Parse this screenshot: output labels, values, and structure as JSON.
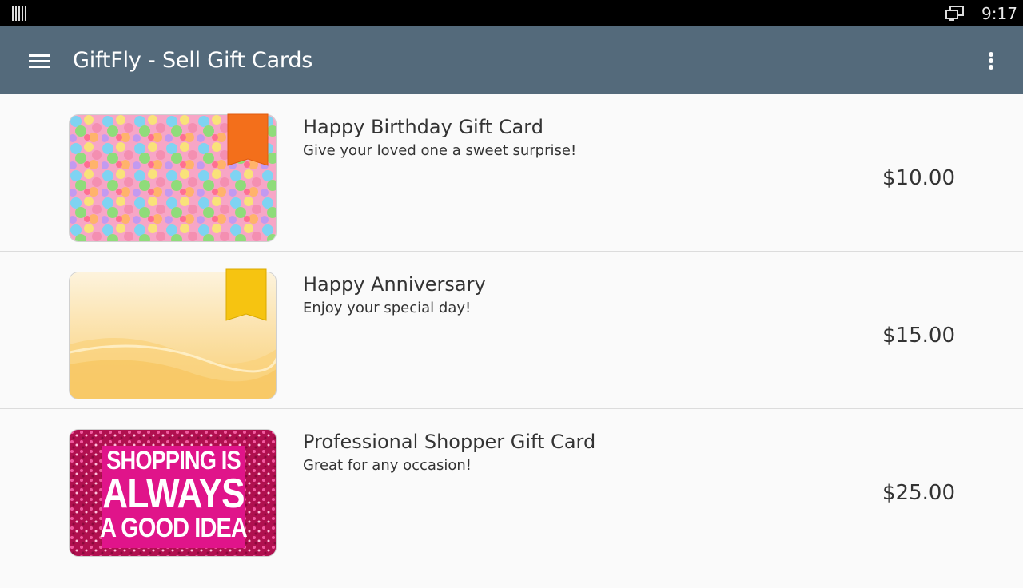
{
  "status_bar": {
    "time": "9:17"
  },
  "app_bar": {
    "title": "GiftFly - Sell Gift Cards"
  },
  "cards": [
    {
      "title": "Happy Birthday Gift Card",
      "description": "Give your loved one a sweet surprise!",
      "price": "$10.00",
      "ribbon_color": "#f36f1b"
    },
    {
      "title": "Happy Anniversary",
      "description": "Enjoy your special day!",
      "price": "$15.00",
      "ribbon_color": "#f6c411"
    },
    {
      "title": "Professional Shopper Gift Card",
      "description": "Great for any occasion!",
      "price": "$25.00",
      "image_text": [
        "SHOPPING IS",
        "ALWAYS",
        "A GOOD IDEA"
      ]
    }
  ],
  "colors": {
    "app_bar": "#546a7b",
    "status_bar": "#000000",
    "background": "#fafafa"
  }
}
